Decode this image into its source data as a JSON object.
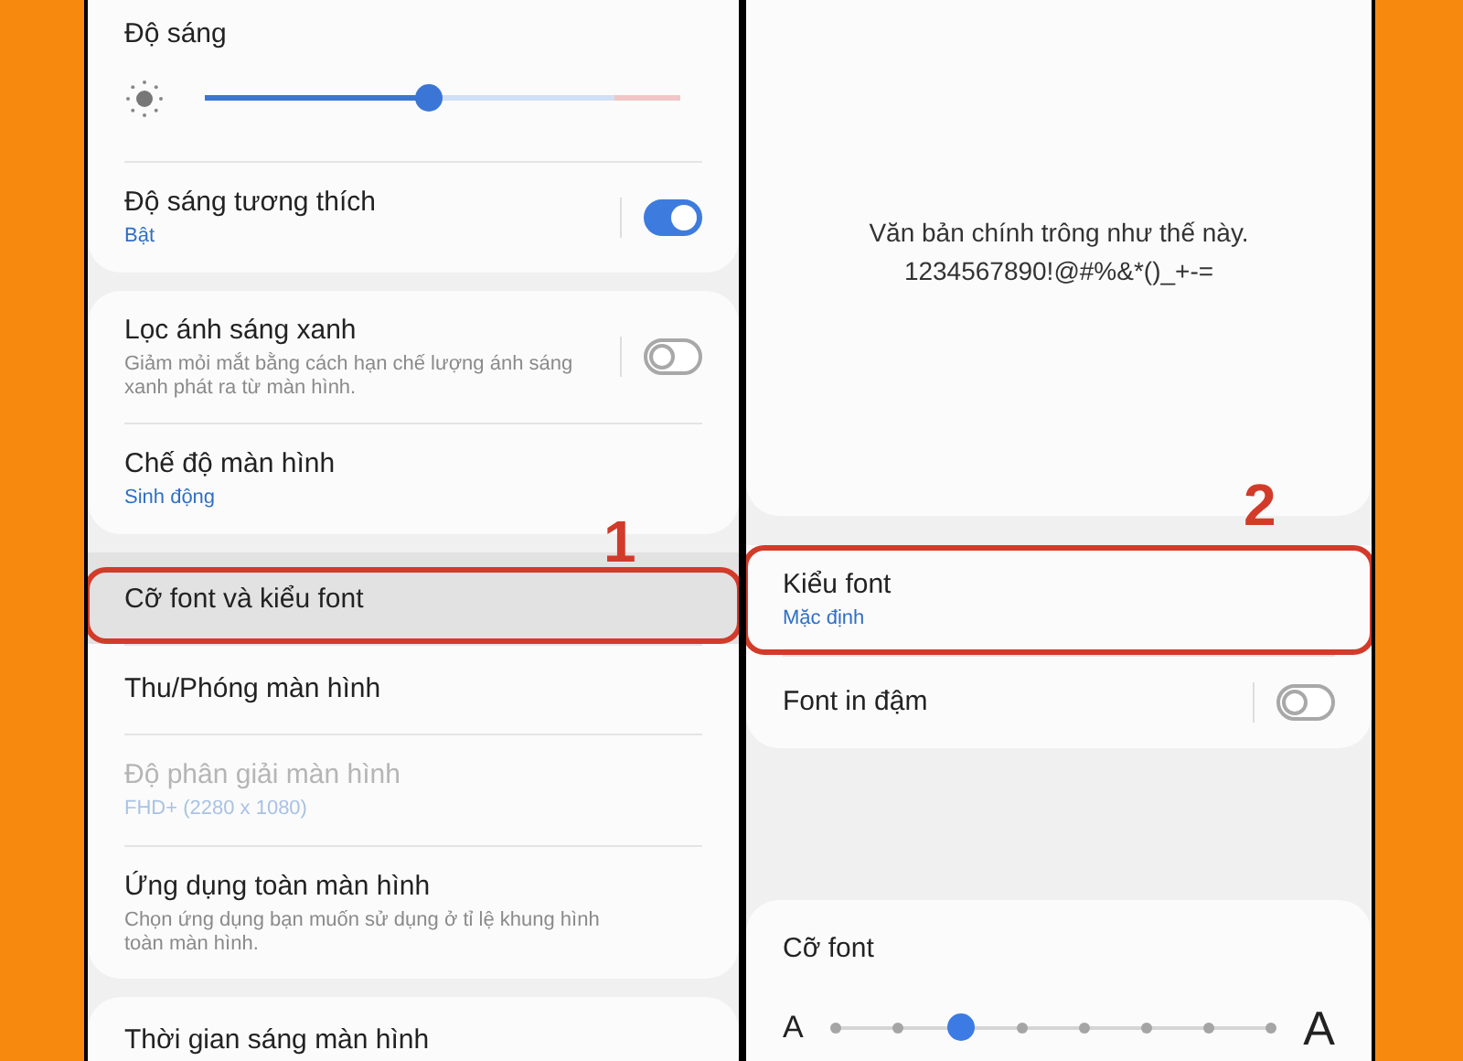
{
  "left_screen": {
    "step_label": "1",
    "cards": [
      {
        "items": [
          {
            "kind": "slider",
            "title": "Độ sáng",
            "level": 0.47
          },
          {
            "kind": "toggle",
            "title": "Độ sáng tương thích",
            "subtitle": "Bật",
            "on": true
          }
        ]
      },
      {
        "items": [
          {
            "kind": "toggle",
            "title": "Lọc ánh sáng xanh",
            "description": "Giảm mỏi mắt bằng cách hạn chế lượng ánh sáng xanh phát ra từ màn hình.",
            "on": false
          },
          {
            "kind": "nav",
            "title": "Chế độ màn hình",
            "subtitle": "Sinh động",
            "disabled": false,
            "highlighted": false,
            "outlined": false
          }
        ]
      },
      {
        "items": [
          {
            "kind": "nav",
            "title": "Cỡ font và kiểu font",
            "disabled": false,
            "highlighted": true,
            "outlined": true
          },
          {
            "kind": "nav",
            "title": "Thu/Phóng màn hình",
            "disabled": false,
            "highlighted": false,
            "outlined": false
          },
          {
            "kind": "nav",
            "title": "Độ phân giải màn hình",
            "subtitle": "FHD+ (2280 x 1080)",
            "disabled": true,
            "highlighted": false,
            "outlined": false
          },
          {
            "kind": "nav",
            "title": "Ứng dụng toàn màn hình",
            "description": "Chọn ứng dụng bạn muốn sử dụng ở tỉ lệ khung hình toàn màn hình.",
            "disabled": false,
            "highlighted": false,
            "outlined": false
          }
        ]
      },
      {
        "items": [
          {
            "kind": "nav",
            "title": "Thời gian sáng màn hình",
            "disabled": false,
            "highlighted": false,
            "outlined": false
          }
        ]
      }
    ]
  },
  "right_screen": {
    "step_label": "2",
    "preview": {
      "lines": [
        "Văn bản chính trông như thế này.",
        "1234567890!@#%&*()_+-="
      ]
    },
    "cards": [
      {
        "items": [
          {
            "kind": "nav",
            "title": "Kiểu font",
            "subtitle": "Mặc định",
            "disabled": false,
            "highlighted": false,
            "outlined": true
          },
          {
            "kind": "toggle",
            "title": "Font in đậm",
            "on": false
          }
        ]
      }
    ],
    "font_size": {
      "title": "Cỡ font",
      "small_label": "A",
      "large_label": "A",
      "level": 0.2857
    }
  }
}
